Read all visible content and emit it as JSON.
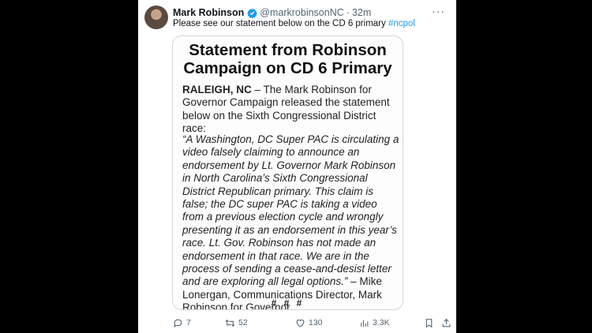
{
  "tweet": {
    "author_name": "Mark Robinson",
    "handle": "@markrobinsonNC",
    "separator": "·",
    "time": "32m",
    "text": "Please see our statement below on the CD 6 primary ",
    "hashtag": "#ncpol",
    "more": "···"
  },
  "statement": {
    "title": "Statement from Robinson Campaign on CD 6 Primary",
    "dateline": "RALEIGH, NC",
    "intro": " – The Mark Robinson for Governor Campaign released the statement below on the Sixth Congressional District race:",
    "quote": "“A Washington, DC Super PAC is circulating a video falsely claiming to announce an endorsement by Lt. Governor Mark Robinson in North Carolina’s Sixth Congressional District Republican primary. This claim is false; the DC super PAC is taking a video from a previous election cycle and wrongly presenting it as an endorsement in this year’s race. Lt. Gov. Robinson has not made an endorsement in that race. We are in the process of sending a cease-and-desist letter and are exploring all legal options.”",
    "attribution": " – Mike Lonergan, Communications Director, Mark Robinson for Governor",
    "end_mark": "# # #"
  },
  "actions": {
    "replies": "7",
    "reposts": "52",
    "likes": "130",
    "views": "3.3K"
  },
  "colors": {
    "accent": "#1d9bf0",
    "muted": "#536471",
    "text": "#0f1419"
  },
  "icons": {
    "avatar": "avatar-photo",
    "verified": "verified-badge-icon",
    "reply": "reply-icon",
    "repost": "repost-icon",
    "like": "heart-icon",
    "views": "views-chart-icon",
    "bookmark": "bookmark-icon",
    "share": "share-icon"
  }
}
